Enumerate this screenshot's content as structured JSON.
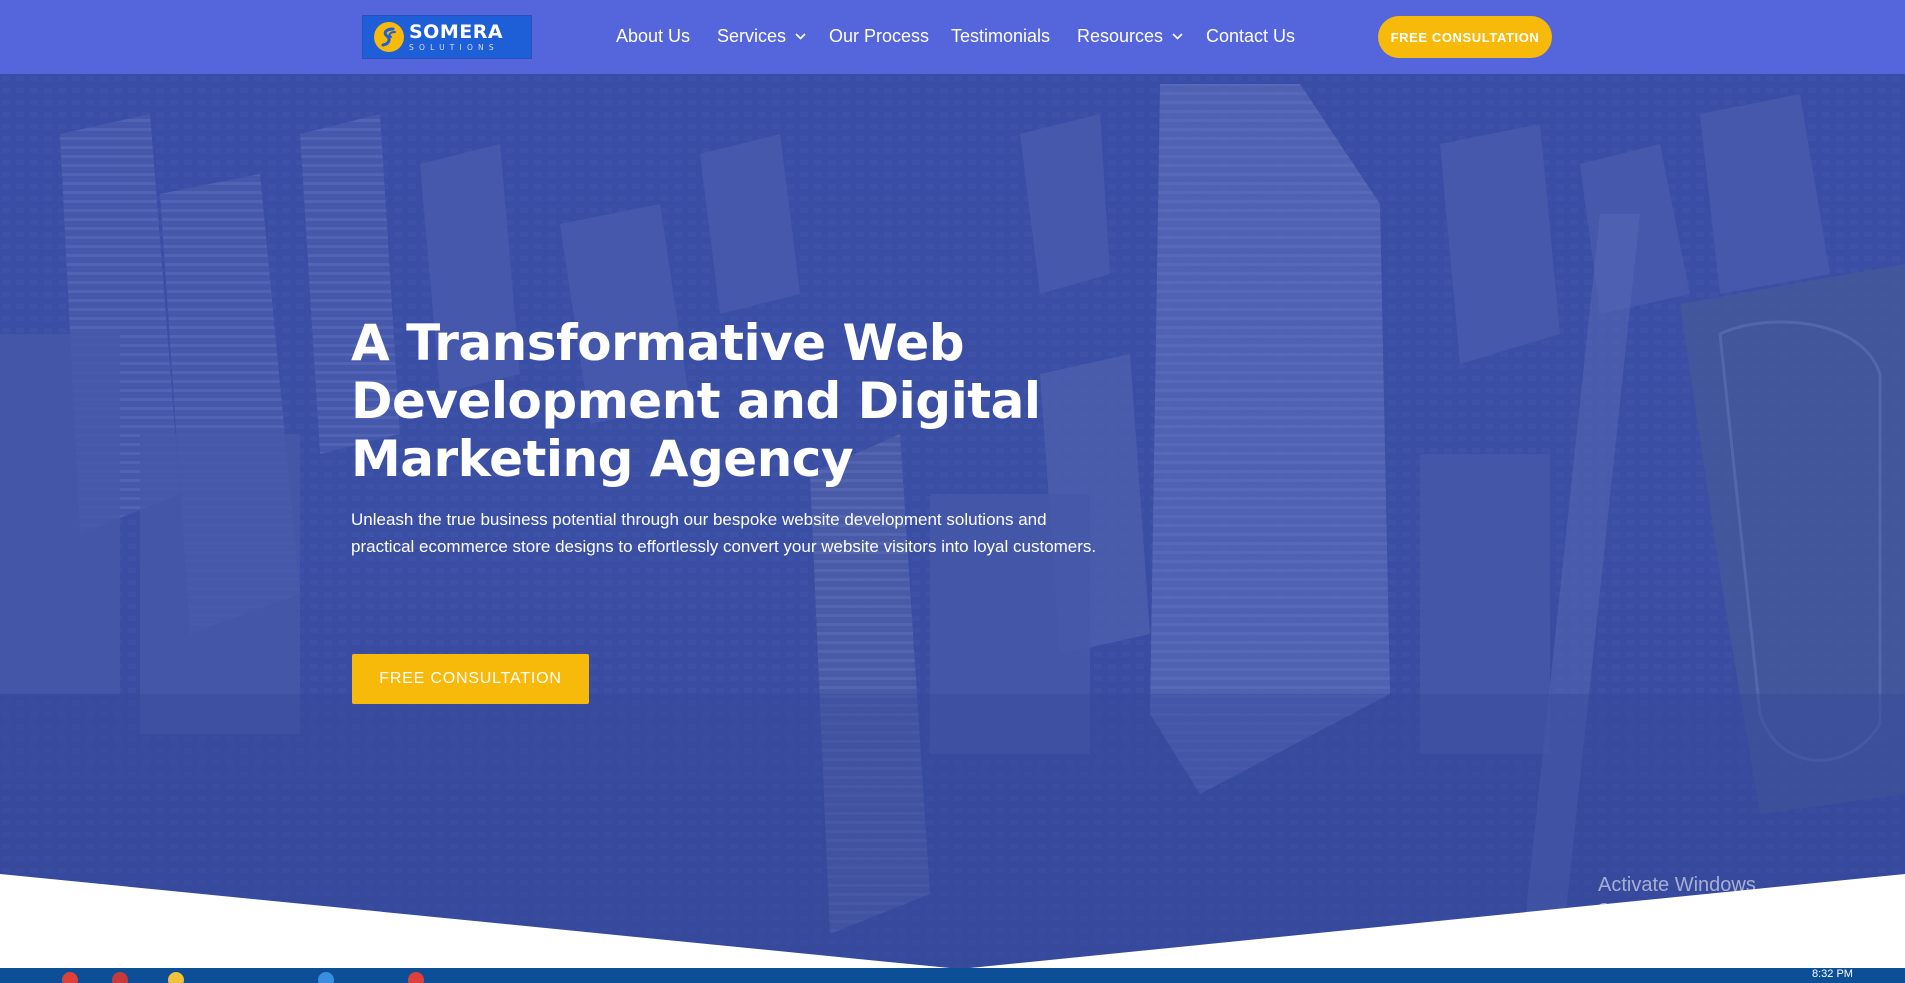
{
  "brand": {
    "name": "SOMERA",
    "tagline": "SOLUTIONS"
  },
  "nav": {
    "items": [
      {
        "label": "About Us",
        "has_dropdown": false
      },
      {
        "label": "Services",
        "has_dropdown": true
      },
      {
        "label": "Our Process",
        "has_dropdown": false
      },
      {
        "label": "Testimonials",
        "has_dropdown": false
      },
      {
        "label": "Resources",
        "has_dropdown": true
      },
      {
        "label": "Contact Us",
        "has_dropdown": false
      }
    ],
    "cta_label": "FREE CONSULTATION"
  },
  "hero": {
    "title_lines": [
      "A Transformative Web",
      "Development and Digital",
      "Marketing Agency"
    ],
    "description_lines": [
      "Unleash the true business potential through our bespoke website development solutions and",
      "practical ecommerce store designs to effortlessly convert your website visitors into loyal customers."
    ],
    "cta_label": "FREE CONSULTATION"
  },
  "watermark": {
    "title": "Activate Windows",
    "subtitle": "Go to Settings to activate Windows."
  },
  "taskbar": {
    "time": "8:32 PM"
  },
  "colors": {
    "header": "#5565dc",
    "accent": "#f7b90a",
    "hero_overlay": "#3c50b4",
    "taskbar": "#0d4f96"
  }
}
